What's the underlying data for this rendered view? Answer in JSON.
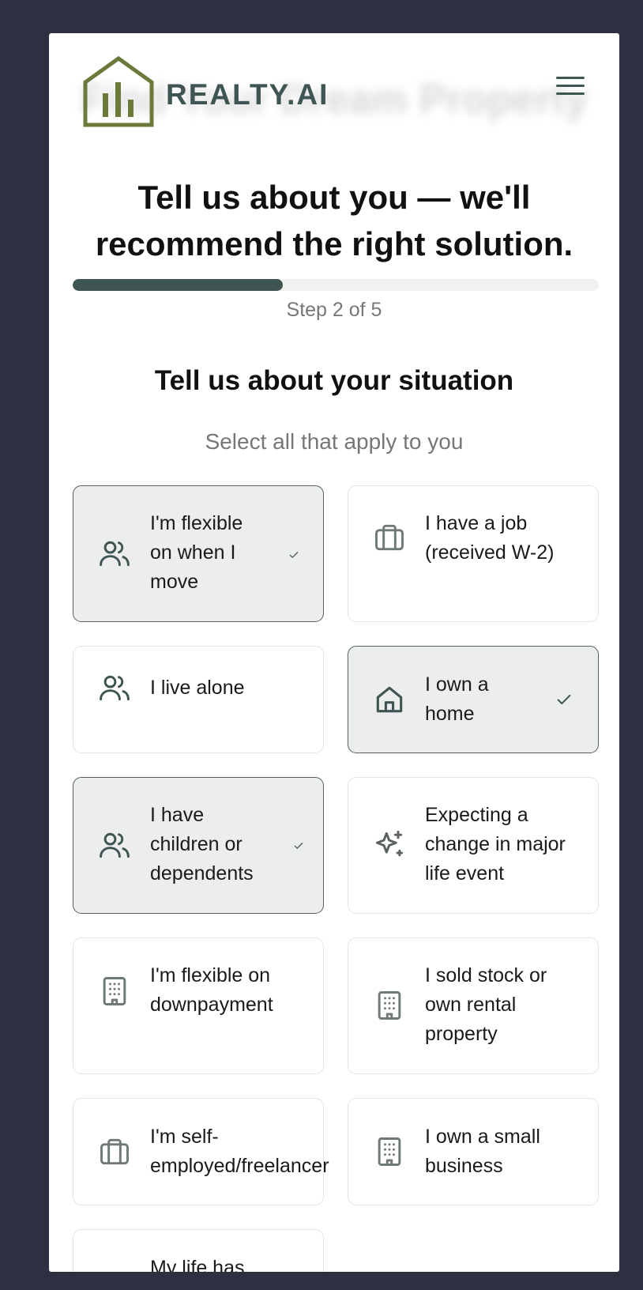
{
  "brand": {
    "name": "REALTY.AI",
    "ghost_title": "Find Your Dream Property"
  },
  "headline": "Tell us about you — we'll recommend the right solution.",
  "progress": {
    "step_text": "Step 2 of 5",
    "fraction": 0.4
  },
  "section": {
    "title": "Tell us about your situation",
    "subtitle": "Select all that apply to you"
  },
  "options": [
    {
      "label": "I'm flexible on when I move",
      "icon": "people-icon",
      "selected": true
    },
    {
      "label": "I have a job (received W-2)",
      "icon": "briefcase-icon",
      "selected": false
    },
    {
      "label": "I live alone",
      "icon": "people-icon",
      "selected": false
    },
    {
      "label": "I own a home",
      "icon": "home-icon",
      "selected": true
    },
    {
      "label": "I have children or dependents",
      "icon": "people-icon",
      "selected": true
    },
    {
      "label": "Expecting a change in major life event",
      "icon": "sparkles-icon",
      "selected": false
    },
    {
      "label": "I'm flexible on downpayment",
      "icon": "building-icon",
      "selected": false
    },
    {
      "label": "I sold stock or own rental property",
      "icon": "building-icon",
      "selected": false
    },
    {
      "label": "I'm self-employed/freelancer",
      "icon": "briefcase-icon",
      "selected": false
    },
    {
      "label": "I own a small business",
      "icon": "building-icon",
      "selected": false
    },
    {
      "label": "My life has",
      "icon": "none",
      "selected": false
    }
  ],
  "colors": {
    "accent": "#3f5553",
    "logo": "#6b7a3a",
    "background": "#2c3040",
    "selected_bg": "#eceeed"
  }
}
